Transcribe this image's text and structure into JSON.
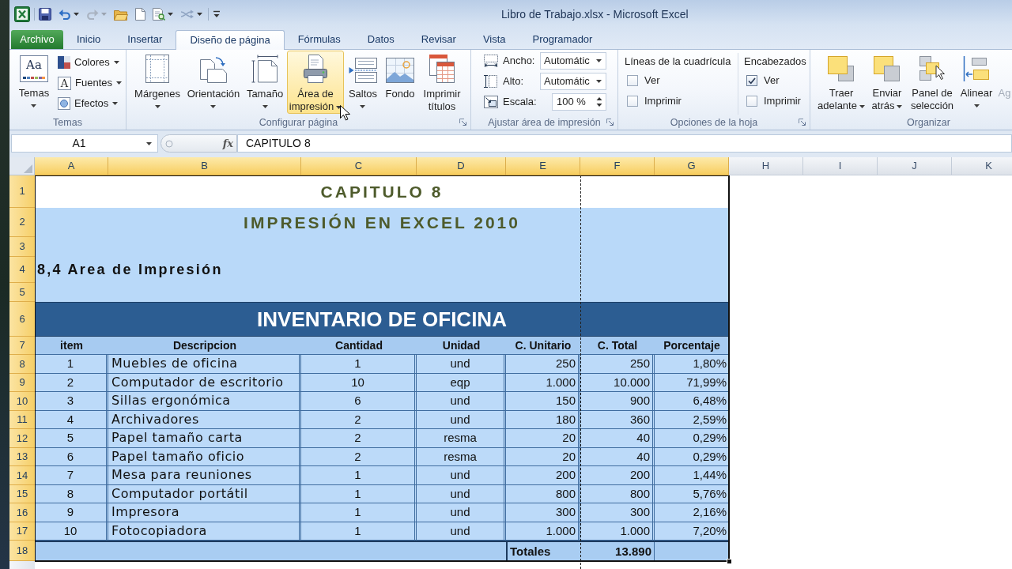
{
  "window": {
    "title": "Libro de Trabajo.xlsx - Microsoft Excel"
  },
  "quick_access": [
    {
      "kind": "save",
      "dropdown": false,
      "disabled": false
    },
    {
      "kind": "undo",
      "dropdown": true,
      "disabled": false
    },
    {
      "kind": "redo",
      "dropdown": true,
      "disabled": true
    },
    {
      "kind": "open",
      "dropdown": false,
      "disabled": false
    },
    {
      "kind": "new",
      "dropdown": false,
      "disabled": false
    },
    {
      "kind": "preview",
      "dropdown": true,
      "disabled": false
    },
    {
      "kind": "connect",
      "dropdown": true,
      "disabled": false
    }
  ],
  "tabs": [
    {
      "kind": "file",
      "label": "Archivo",
      "selected": false
    },
    {
      "kind": "tab",
      "label": "Inicio",
      "selected": false
    },
    {
      "kind": "tab",
      "label": "Insertar",
      "selected": false
    },
    {
      "kind": "tab",
      "label": "Diseño de página",
      "selected": true
    },
    {
      "kind": "tab",
      "label": "Fórmulas",
      "selected": false
    },
    {
      "kind": "tab",
      "label": "Datos",
      "selected": false
    },
    {
      "kind": "tab",
      "label": "Revisar",
      "selected": false
    },
    {
      "kind": "tab",
      "label": "Vista",
      "selected": false
    },
    {
      "kind": "tab",
      "label": "Programador",
      "selected": false
    }
  ],
  "ribbon": {
    "groups": [
      {
        "kind": "themes",
        "label": "Temas",
        "launcher": false,
        "large": {
          "label": "Temas",
          "glyph": "Aa",
          "dropdown": true
        },
        "items": [
          {
            "kind": "colors",
            "label": "Colores",
            "dropdown": true
          },
          {
            "kind": "fonts",
            "label": "Fuentes",
            "glyph": "A",
            "dropdown": true
          },
          {
            "kind": "effects",
            "label": "Efectos",
            "dropdown": true
          }
        ]
      },
      {
        "kind": "page_setup",
        "label": "Configurar página",
        "launcher": true,
        "items": [
          {
            "kind": "margins",
            "label": "Márgenes",
            "dropdown": true,
            "highlighted": false
          },
          {
            "kind": "orientation",
            "label": "Orientación",
            "dropdown": true,
            "highlighted": false
          },
          {
            "kind": "size",
            "label": "Tamaño",
            "dropdown": true,
            "highlighted": false
          },
          {
            "kind": "print_area",
            "label": "Área de impresión",
            "dropdown": true,
            "highlighted": true
          },
          {
            "kind": "breaks",
            "label": "Saltos",
            "dropdown": true,
            "highlighted": false
          },
          {
            "kind": "background",
            "label": "Fondo",
            "dropdown": false,
            "highlighted": false
          },
          {
            "kind": "titles",
            "label": "Imprimir títulos",
            "dropdown": false,
            "highlighted": false
          }
        ]
      },
      {
        "kind": "scale",
        "label": "Ajustar área de impresión",
        "launcher": true,
        "items": [
          {
            "kind": "dropdown",
            "label": "Ancho:",
            "value": "Automátic"
          },
          {
            "kind": "dropdown",
            "label": "Alto:",
            "value": "Automátic"
          },
          {
            "kind": "spinner",
            "label": "Escala:",
            "value": "100 %"
          }
        ]
      },
      {
        "kind": "sheet_options",
        "label": "Opciones de la hoja",
        "launcher": true,
        "columns": [
          {
            "title": "Líneas de la cuadrícula",
            "options": [
              {
                "label": "Ver",
                "checked": false
              },
              {
                "label": "Imprimir",
                "checked": false
              }
            ]
          },
          {
            "title": "Encabezados",
            "options": [
              {
                "label": "Ver",
                "checked": true
              },
              {
                "label": "Imprimir",
                "checked": false
              }
            ]
          }
        ]
      },
      {
        "kind": "arrange",
        "label": "Organizar",
        "launcher": false,
        "items": [
          {
            "kind": "forward",
            "label": "Traer adelante",
            "dropdown": true,
            "disabled": false
          },
          {
            "kind": "backward",
            "label": "Enviar atrás",
            "dropdown": true,
            "disabled": false
          },
          {
            "kind": "selection",
            "label": "Panel de selección",
            "dropdown": false,
            "disabled": false
          },
          {
            "kind": "align",
            "label": "Alinear",
            "dropdown": true,
            "disabled": false
          },
          {
            "kind": "group",
            "label": "Ag",
            "dropdown": false,
            "disabled": true
          }
        ]
      }
    ]
  },
  "formula_bar": {
    "name_box": "A1",
    "function_button": "fx",
    "formula": "CAPITULO 8"
  },
  "sheet": {
    "columns": [
      {
        "label": "A",
        "selected": true
      },
      {
        "label": "B",
        "selected": true
      },
      {
        "label": "C",
        "selected": true
      },
      {
        "label": "D",
        "selected": true
      },
      {
        "label": "E",
        "selected": true
      },
      {
        "label": "F",
        "selected": true
      },
      {
        "label": "G",
        "selected": true
      },
      {
        "label": "H",
        "selected": false
      },
      {
        "label": "I",
        "selected": false
      },
      {
        "label": "J",
        "selected": false
      },
      {
        "label": "K",
        "selected": false
      }
    ],
    "rows": [
      {
        "label": "1",
        "selected": true
      },
      {
        "label": "2",
        "selected": true
      },
      {
        "label": "3",
        "selected": true
      },
      {
        "label": "4",
        "selected": true
      },
      {
        "label": "5",
        "selected": true
      },
      {
        "label": "6",
        "selected": true
      },
      {
        "label": "7",
        "selected": true
      },
      {
        "label": "8",
        "selected": true
      },
      {
        "label": "9",
        "selected": true
      },
      {
        "label": "10",
        "selected": true
      },
      {
        "label": "11",
        "selected": true
      },
      {
        "label": "12",
        "selected": true
      },
      {
        "label": "13",
        "selected": true
      },
      {
        "label": "14",
        "selected": true
      },
      {
        "label": "15",
        "selected": true
      },
      {
        "label": "16",
        "selected": true
      },
      {
        "label": "17",
        "selected": true
      },
      {
        "label": "18",
        "selected": true
      }
    ],
    "title": "CAPITULO 8",
    "subtitle": "IMPRESIÓN EN EXCEL 2010",
    "section": "8,4 Area de Impresión",
    "table_title": "INVENTARIO DE OFICINA",
    "table": {
      "columns": [
        "item",
        "Descripcion",
        "Cantidad",
        "Unidad",
        "C. Unitario",
        "C. Total",
        "Porcentaje"
      ],
      "rows": [
        [
          "1",
          "Muebles de oficina",
          "1",
          "und",
          "250",
          "250",
          "1,80%"
        ],
        [
          "2",
          "Computador de escritorio",
          "10",
          "eqp",
          "1.000",
          "10.000",
          "71,99%"
        ],
        [
          "3",
          "Sillas ergonómica",
          "6",
          "und",
          "150",
          "900",
          "6,48%"
        ],
        [
          "4",
          "Archivadores",
          "2",
          "und",
          "180",
          "360",
          "2,59%"
        ],
        [
          "5",
          "Papel tamaño carta",
          "2",
          "resma",
          "20",
          "40",
          "0,29%"
        ],
        [
          "6",
          "Papel tamaño oficio",
          "2",
          "resma",
          "20",
          "40",
          "0,29%"
        ],
        [
          "7",
          "Mesa para reuniones",
          "1",
          "und",
          "200",
          "200",
          "1,44%"
        ],
        [
          "8",
          "Computador portátil",
          "1",
          "und",
          "800",
          "800",
          "5,76%"
        ],
        [
          "9",
          "Impresora",
          "1",
          "und",
          "300",
          "300",
          "2,16%"
        ],
        [
          "10",
          "Fotocopiadora",
          "1",
          "und",
          "1.000",
          "1.000",
          "7,20%"
        ]
      ],
      "totals_label": "Totales",
      "totals_value": "13.890"
    }
  }
}
